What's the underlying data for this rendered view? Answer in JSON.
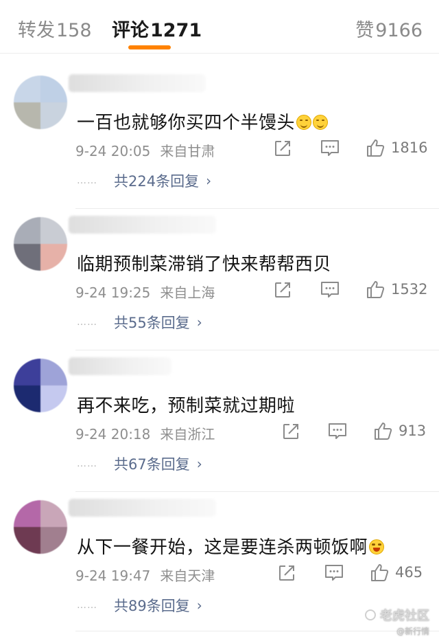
{
  "tabs": {
    "repost": {
      "label": "转发",
      "count": "158"
    },
    "comments": {
      "label": "评论",
      "count": "1271"
    },
    "likes": {
      "label": "赞",
      "count": "9166"
    }
  },
  "comments": [
    {
      "text": "一百也就够你买四个半馒头",
      "emoji": "smile-emoji",
      "time": "9-24 20:05",
      "location": "来自甘肃",
      "likes": "1816",
      "replies": "共224条回复"
    },
    {
      "text": "临期预制菜滞销了快来帮帮西贝",
      "emoji": "",
      "time": "9-24 19:25",
      "location": "来自上海",
      "likes": "1532",
      "replies": "共55条回复"
    },
    {
      "text": "再不来吃，预制菜就过期啦",
      "emoji": "",
      "time": "9-24 20:18",
      "location": "来自浙江",
      "likes": "913",
      "replies": "共67条回复"
    },
    {
      "text": "从下一餐开始，这是要连杀两顿饭啊",
      "emoji": "laugh-cry-emoji",
      "time": "9-24 19:47",
      "location": "来自天津",
      "likes": "465",
      "replies": "共89条回复"
    }
  ],
  "reply_dots": "……",
  "reply_chevron": "›",
  "watermark": {
    "brand": "老虎社区",
    "sub": "@新行情"
  },
  "colors": {
    "accent": "#ff8200",
    "reply_link": "#5a6b8c",
    "muted": "#8e8e8e"
  }
}
